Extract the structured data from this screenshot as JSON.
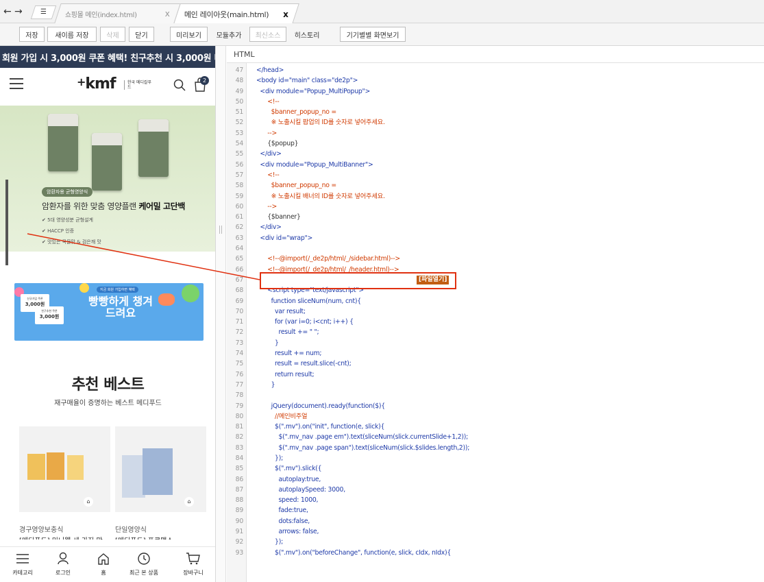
{
  "tabbar": {
    "back": "←",
    "forward": "→",
    "list_icon": "☰",
    "tabs": [
      {
        "label": "쇼핑몰 메인(index.html)",
        "close": "x"
      },
      {
        "label": "메인 레이아웃(main.html)",
        "close": "x"
      }
    ]
  },
  "toolbar": {
    "save": "저장",
    "save_as": "새이름 저장",
    "delete": "삭제",
    "close": "닫기",
    "preview": "미리보기",
    "add_module": "모듈추가",
    "latest": "최신소스",
    "history": "히스토리",
    "device_view": "기기별별 화면보기"
  },
  "preview": {
    "promo": "회원 가입 시 3,000원 쿠폰 혜택! 친구추천 시 3,000원 더!",
    "logo": "kmf",
    "logo_sub": "한국 메디칼푸드",
    "cart_count": "2",
    "hero": {
      "badge": "암환자용 균형영양식",
      "title_plain": "암환자를 위한 맞춤 영양플랜 ",
      "title_bold": "케어밀 고단백",
      "checks": [
        "✔ 5대 영양성분 균형설계",
        "✔ HACCP 인증",
        "✔ 맛있는 곡물맛 & 검은깨 맛"
      ]
    },
    "coupon": {
      "top": "지금 회원 가입하면 혜택",
      "main": "빵빵하게 챙겨드려요",
      "ticket1_line": "신규가입 쿠폰",
      "ticket1_amt": "3,000원",
      "ticket2_line": "친구추천 쿠폰",
      "ticket2_amt": "3,000원"
    },
    "best_title": "추천 베스트",
    "best_sub": "재구매율이 증명하는 베스트 메디푸드",
    "products": [
      {
        "category": "경구영양보충식",
        "name": "[메디푸드] 미니웰 세 가지 맛"
      },
      {
        "category": "단일영양식",
        "name": "[메디푸드] 프로맥스"
      }
    ],
    "bag_icon": "⌂",
    "bottom_nav": [
      {
        "label": "카테고리",
        "icon": "menu-icon"
      },
      {
        "label": "로그인",
        "icon": "user-icon"
      },
      {
        "label": "홈",
        "icon": "home-icon"
      },
      {
        "label": "최근 본 상품",
        "icon": "clock-icon"
      },
      {
        "label": "장바구니",
        "icon": "cart-icon"
      }
    ]
  },
  "editor": {
    "header": "HTML",
    "file_open_badge": "[파일열기]",
    "lines": [
      {
        "no": "47",
        "parts": [
          [
            "tag",
            "</head>"
          ]
        ]
      },
      {
        "no": "48",
        "parts": [
          [
            "tag",
            "<body id=\"main\" class=\"de2p\">"
          ]
        ]
      },
      {
        "no": "49",
        "parts": [
          [
            "tag",
            "  <div module=\"Popup_MultiPopup\">"
          ]
        ]
      },
      {
        "no": "50",
        "parts": [
          [
            "cm",
            "      <!--"
          ]
        ]
      },
      {
        "no": "51",
        "parts": [
          [
            "cm",
            "        $banner_popup_no ="
          ]
        ]
      },
      {
        "no": "52",
        "parts": [
          [
            "cm",
            "        ※ 노출시킬 팝업의 ID를 숫자로 넣어주세요."
          ]
        ]
      },
      {
        "no": "53",
        "parts": [
          [
            "cm",
            "      -->"
          ]
        ]
      },
      {
        "no": "54",
        "parts": [
          [
            "tx",
            "      {$popup}"
          ]
        ]
      },
      {
        "no": "55",
        "parts": [
          [
            "tag",
            "  </div>"
          ]
        ]
      },
      {
        "no": "56",
        "parts": [
          [
            "tag",
            "  <div module=\"Popup_MultiBanner\">"
          ]
        ]
      },
      {
        "no": "57",
        "parts": [
          [
            "cm",
            "      <!--"
          ]
        ]
      },
      {
        "no": "58",
        "parts": [
          [
            "cm",
            "        $banner_popup_no ="
          ]
        ]
      },
      {
        "no": "59",
        "parts": [
          [
            "cm",
            "        ※ 노출시킬 배너의 ID를 숫자로 넣어주세요."
          ]
        ]
      },
      {
        "no": "60",
        "parts": [
          [
            "cm",
            "      -->"
          ]
        ]
      },
      {
        "no": "61",
        "parts": [
          [
            "tx",
            "      {$banner}"
          ]
        ]
      },
      {
        "no": "62",
        "parts": [
          [
            "tag",
            "  </div>"
          ]
        ]
      },
      {
        "no": "63",
        "parts": [
          [
            "tag",
            "  <div id=\"wrap\">"
          ]
        ]
      },
      {
        "no": "64",
        "parts": [
          [
            "tx",
            ""
          ]
        ]
      },
      {
        "no": "65",
        "parts": [
          [
            "cm",
            "      <!--@import(/_de2p/html/_/sidebar.html)-->"
          ]
        ]
      },
      {
        "no": "66",
        "parts": [
          [
            "cm",
            "      <!--@import(/_de2p/html/_/header.html)-->"
          ]
        ]
      },
      {
        "no": "67",
        "parts": [
          [
            "tx",
            ""
          ]
        ]
      },
      {
        "no": "68",
        "parts": [
          [
            "tag",
            "      <script type=\"text/javascript\">"
          ]
        ]
      },
      {
        "no": "69",
        "parts": [
          [
            "kw",
            "        function sliceNum(num, cnt){"
          ]
        ]
      },
      {
        "no": "70",
        "parts": [
          [
            "kw",
            "          var result;"
          ]
        ]
      },
      {
        "no": "71",
        "parts": [
          [
            "kw",
            "          for (var i=0; i<cnt; i++) {"
          ]
        ]
      },
      {
        "no": "72",
        "parts": [
          [
            "kw",
            "            result += \" \";"
          ]
        ]
      },
      {
        "no": "73",
        "parts": [
          [
            "kw",
            "          }"
          ]
        ]
      },
      {
        "no": "74",
        "parts": [
          [
            "kw",
            "          result += num;"
          ]
        ]
      },
      {
        "no": "75",
        "parts": [
          [
            "kw",
            "          result = result.slice(-cnt);"
          ]
        ]
      },
      {
        "no": "76",
        "parts": [
          [
            "kw",
            "          return result;"
          ]
        ]
      },
      {
        "no": "77",
        "parts": [
          [
            "kw",
            "        }"
          ]
        ]
      },
      {
        "no": "78",
        "parts": [
          [
            "tx",
            ""
          ]
        ]
      },
      {
        "no": "79",
        "parts": [
          [
            "kw",
            "        jQuery(document).ready(function($){"
          ]
        ]
      },
      {
        "no": "80",
        "parts": [
          [
            "cm",
            "          //메인비주얼"
          ]
        ]
      },
      {
        "no": "81",
        "parts": [
          [
            "kw",
            "          $(\".mv\").on(\"init\", function(e, slick){"
          ]
        ]
      },
      {
        "no": "82",
        "parts": [
          [
            "kw",
            "            $(\".mv_nav .page em\").text(sliceNum(slick.currentSlide+1,2));"
          ]
        ]
      },
      {
        "no": "83",
        "parts": [
          [
            "kw",
            "            $(\".mv_nav .page span\").text(sliceNum(slick.$slides.length,2));"
          ]
        ]
      },
      {
        "no": "84",
        "parts": [
          [
            "kw",
            "          });"
          ]
        ]
      },
      {
        "no": "85",
        "parts": [
          [
            "kw",
            "          $(\".mv\").slick({"
          ]
        ]
      },
      {
        "no": "86",
        "parts": [
          [
            "kw",
            "            autoplay:true,"
          ]
        ]
      },
      {
        "no": "87",
        "parts": [
          [
            "kw",
            "            autoplaySpeed: 3000,"
          ]
        ]
      },
      {
        "no": "88",
        "parts": [
          [
            "kw",
            "            speed: 1000,"
          ]
        ]
      },
      {
        "no": "89",
        "parts": [
          [
            "kw",
            "            fade:true,"
          ]
        ]
      },
      {
        "no": "90",
        "parts": [
          [
            "kw",
            "            dots:false,"
          ]
        ]
      },
      {
        "no": "91",
        "parts": [
          [
            "kw",
            "            arrows: false,"
          ]
        ]
      },
      {
        "no": "92",
        "parts": [
          [
            "kw",
            "          });"
          ]
        ]
      },
      {
        "no": "93",
        "parts": [
          [
            "kw",
            "          $(\".mv\").on(\"beforeChange\", function(e, slick, cIdx, nIdx){"
          ]
        ]
      }
    ]
  },
  "colors": {
    "promo_bg": "#2d3b55",
    "highlight_border": "#e03010",
    "file_open_bg": "#c25d12",
    "code_tag": "#1e3aa8",
    "code_comment": "#d03a00",
    "hero_green": "#d7e6c4",
    "coupon_blue": "#5aa9eb"
  }
}
